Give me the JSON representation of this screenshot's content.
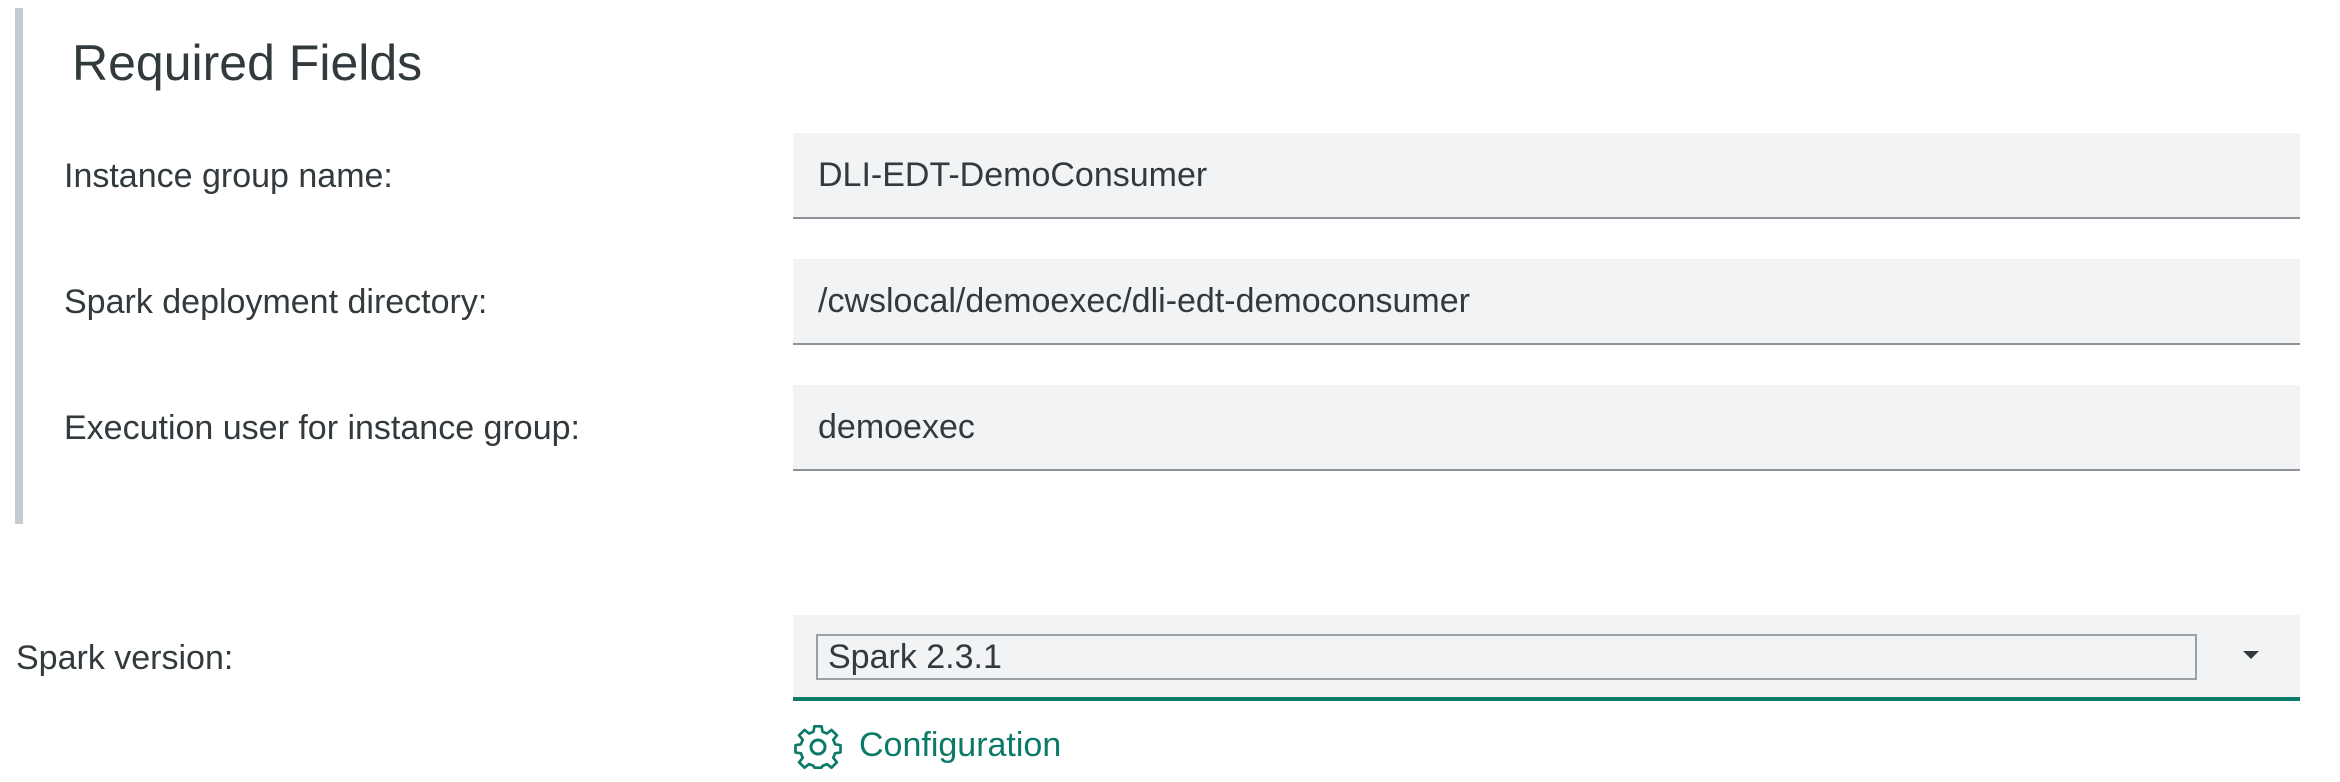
{
  "required_fields": {
    "title": "Required Fields",
    "fields": [
      {
        "label": "Instance group name:",
        "value": "DLI-EDT-DemoConsumer"
      },
      {
        "label": "Spark deployment directory:",
        "value": "/cwslocal/demoexec/dli-edt-democonsumer"
      },
      {
        "label": "Execution user for instance group:",
        "value": "demoexec"
      }
    ]
  },
  "spark_version": {
    "label": "Spark version:",
    "selected": "Spark 2.3.1"
  },
  "configuration": {
    "label": "Configuration",
    "icon": "gear-icon"
  },
  "colors": {
    "accent": "#0b7a68",
    "field_bg": "#f2f3f4",
    "section_bar": "#c7ccd1",
    "text": "#323a3e"
  }
}
